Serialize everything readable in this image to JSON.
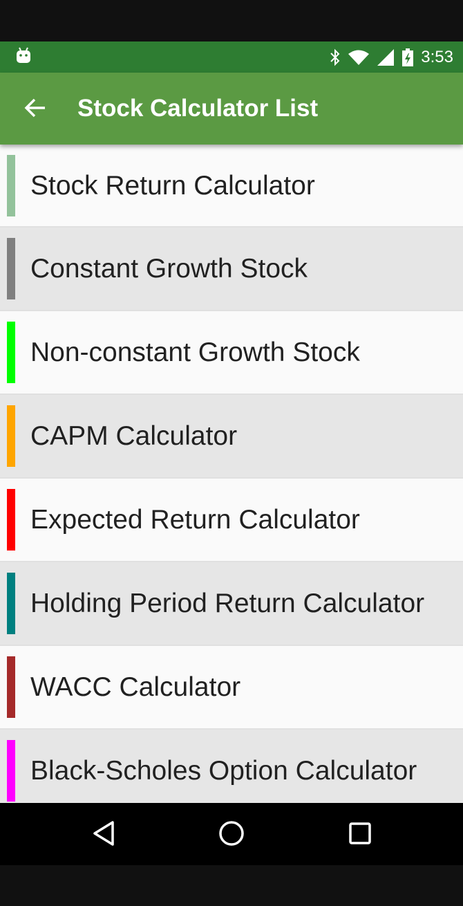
{
  "status_bar": {
    "time": "3:53",
    "background": "#2e7d32",
    "icons": [
      "android-icon",
      "bluetooth-icon",
      "wifi-icon",
      "cell-signal-icon",
      "battery-charging-icon"
    ]
  },
  "app_bar": {
    "title": "Stock Calculator List",
    "background": "#5b9a43",
    "back_icon": "arrow-back-icon"
  },
  "list": {
    "items": [
      {
        "label": "Stock Return Calculator",
        "color": "#93c29b"
      },
      {
        "label": "Constant Growth Stock",
        "color": "#808080"
      },
      {
        "label": "Non-constant Growth Stock",
        "color": "#00ff00"
      },
      {
        "label": "CAPM Calculator",
        "color": "#ffa500"
      },
      {
        "label": "Expected Return Calculator",
        "color": "#ff0000"
      },
      {
        "label": "Holding Period Return Calculator",
        "color": "#008080"
      },
      {
        "label": "WACC Calculator",
        "color": "#a52a2a"
      },
      {
        "label": "Black-Scholes Option Calculator",
        "color": "#ff00ff"
      }
    ]
  },
  "nav_bar": {
    "buttons": [
      "back-triangle-icon",
      "home-circle-icon",
      "recents-square-icon"
    ]
  }
}
